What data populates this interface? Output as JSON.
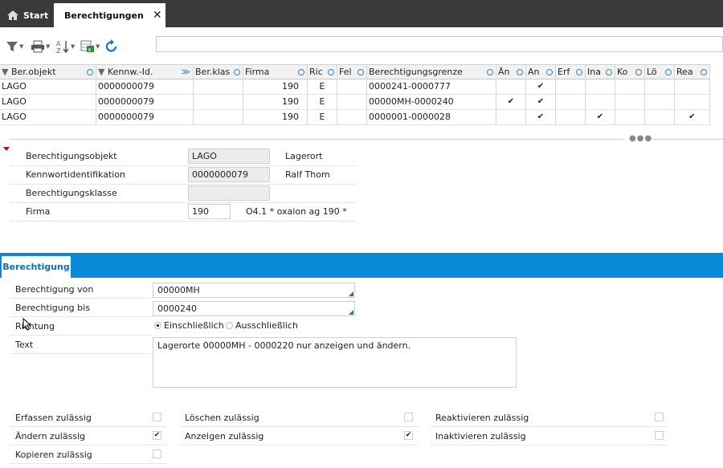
{
  "tabs": [
    {
      "label": "Start",
      "icon": "home-icon"
    },
    {
      "label": "Berechtigungen",
      "icon": "permissions-icon",
      "close": "✕"
    }
  ],
  "grid": {
    "columns": [
      "Ber.objekt",
      "Kennw.-Id.",
      "Ber.klas",
      "Firma",
      "Ric",
      "Fel",
      "Berechtigungsgrenze",
      "Än",
      "An",
      "Erf",
      "Ina",
      "Ko",
      "Lö",
      "Rea"
    ],
    "rows": [
      {
        "obj": "LAGO",
        "kid": "0000000079",
        "klas": "",
        "firma": "190",
        "ric": "E",
        "fel": "",
        "grenze": "0000241-0000777",
        "aen": "",
        "an": "✔",
        "erf": "",
        "ina": "",
        "ko": "",
        "loe": "",
        "rea": ""
      },
      {
        "obj": "LAGO",
        "kid": "0000000079",
        "klas": "",
        "firma": "190",
        "ric": "E",
        "fel": "",
        "grenze": "00000MH-0000240",
        "aen": "✔",
        "an": "✔",
        "erf": "",
        "ina": "",
        "ko": "",
        "loe": "",
        "rea": ""
      },
      {
        "obj": "LAGO",
        "kid": "0000000079",
        "klas": "",
        "firma": "190",
        "ric": "E",
        "fel": "",
        "grenze": "0000001-0000028",
        "aen": "",
        "an": "✔",
        "erf": "",
        "ina": "✔",
        "ko": "",
        "loe": "",
        "rea": "✔"
      }
    ]
  },
  "detail": {
    "objekt_label": "Berechtigungsobjekt",
    "objekt_value": "LAGO",
    "objekt_text": "Lagerort",
    "kennwort_label": "Kennwortidentifikation",
    "kennwort_value": "0000000079",
    "kennwort_text": "Ralf Thom",
    "klasse_label": "Berechtigungsklasse",
    "klasse_value": "",
    "firma_label": "Firma",
    "firma_value": "190",
    "firma_text": "O4.1 * oxaion ag 190   *"
  },
  "section": {
    "tab_label": "Berechtigung"
  },
  "form": {
    "von_label": "Berechtigung von",
    "von_value": "00000MH",
    "bis_label": "Berechtigung bis",
    "bis_value": "0000240",
    "richtung_label": "Richtung",
    "radio_ein": "Einschließlich",
    "radio_aus": "Ausschließlich",
    "text_label": "Text",
    "text_value": "Lagerorte 00000MH - 0000220 nur anzeigen und ändern."
  },
  "checkboxes": {
    "erfassen": {
      "label": "Erfassen zulässig",
      "checked": ""
    },
    "aendern": {
      "label": "Ändern zulässig",
      "checked": "✔"
    },
    "kopieren": {
      "label": "Kopieren zulässig",
      "checked": ""
    },
    "loeschen": {
      "label": "Löschen zulässig",
      "checked": ""
    },
    "anzeigen": {
      "label": "Anzeigen zulässig",
      "checked": "✔"
    },
    "reaktivieren": {
      "label": "Reaktivieren zulässig",
      "checked": ""
    },
    "inaktivieren": {
      "label": "Inaktivieren zulässig",
      "checked": ""
    }
  },
  "colors": {
    "accent": "#0a8ad6",
    "tabbar": "#3a3a3a"
  }
}
